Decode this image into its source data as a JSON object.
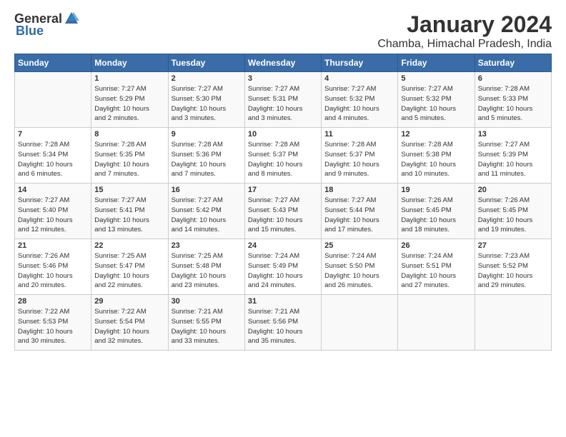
{
  "logo": {
    "general": "General",
    "blue": "Blue"
  },
  "title": {
    "month_year": "January 2024",
    "location": "Chamba, Himachal Pradesh, India"
  },
  "days_of_week": [
    "Sunday",
    "Monday",
    "Tuesday",
    "Wednesday",
    "Thursday",
    "Friday",
    "Saturday"
  ],
  "weeks": [
    [
      {
        "day": "",
        "info": ""
      },
      {
        "day": "1",
        "info": "Sunrise: 7:27 AM\nSunset: 5:29 PM\nDaylight: 10 hours\nand 2 minutes."
      },
      {
        "day": "2",
        "info": "Sunrise: 7:27 AM\nSunset: 5:30 PM\nDaylight: 10 hours\nand 3 minutes."
      },
      {
        "day": "3",
        "info": "Sunrise: 7:27 AM\nSunset: 5:31 PM\nDaylight: 10 hours\nand 3 minutes."
      },
      {
        "day": "4",
        "info": "Sunrise: 7:27 AM\nSunset: 5:32 PM\nDaylight: 10 hours\nand 4 minutes."
      },
      {
        "day": "5",
        "info": "Sunrise: 7:27 AM\nSunset: 5:32 PM\nDaylight: 10 hours\nand 5 minutes."
      },
      {
        "day": "6",
        "info": "Sunrise: 7:28 AM\nSunset: 5:33 PM\nDaylight: 10 hours\nand 5 minutes."
      }
    ],
    [
      {
        "day": "7",
        "info": "Sunrise: 7:28 AM\nSunset: 5:34 PM\nDaylight: 10 hours\nand 6 minutes."
      },
      {
        "day": "8",
        "info": "Sunrise: 7:28 AM\nSunset: 5:35 PM\nDaylight: 10 hours\nand 7 minutes."
      },
      {
        "day": "9",
        "info": "Sunrise: 7:28 AM\nSunset: 5:36 PM\nDaylight: 10 hours\nand 7 minutes."
      },
      {
        "day": "10",
        "info": "Sunrise: 7:28 AM\nSunset: 5:37 PM\nDaylight: 10 hours\nand 8 minutes."
      },
      {
        "day": "11",
        "info": "Sunrise: 7:28 AM\nSunset: 5:37 PM\nDaylight: 10 hours\nand 9 minutes."
      },
      {
        "day": "12",
        "info": "Sunrise: 7:28 AM\nSunset: 5:38 PM\nDaylight: 10 hours\nand 10 minutes."
      },
      {
        "day": "13",
        "info": "Sunrise: 7:27 AM\nSunset: 5:39 PM\nDaylight: 10 hours\nand 11 minutes."
      }
    ],
    [
      {
        "day": "14",
        "info": "Sunrise: 7:27 AM\nSunset: 5:40 PM\nDaylight: 10 hours\nand 12 minutes."
      },
      {
        "day": "15",
        "info": "Sunrise: 7:27 AM\nSunset: 5:41 PM\nDaylight: 10 hours\nand 13 minutes."
      },
      {
        "day": "16",
        "info": "Sunrise: 7:27 AM\nSunset: 5:42 PM\nDaylight: 10 hours\nand 14 minutes."
      },
      {
        "day": "17",
        "info": "Sunrise: 7:27 AM\nSunset: 5:43 PM\nDaylight: 10 hours\nand 15 minutes."
      },
      {
        "day": "18",
        "info": "Sunrise: 7:27 AM\nSunset: 5:44 PM\nDaylight: 10 hours\nand 17 minutes."
      },
      {
        "day": "19",
        "info": "Sunrise: 7:26 AM\nSunset: 5:45 PM\nDaylight: 10 hours\nand 18 minutes."
      },
      {
        "day": "20",
        "info": "Sunrise: 7:26 AM\nSunset: 5:45 PM\nDaylight: 10 hours\nand 19 minutes."
      }
    ],
    [
      {
        "day": "21",
        "info": "Sunrise: 7:26 AM\nSunset: 5:46 PM\nDaylight: 10 hours\nand 20 minutes."
      },
      {
        "day": "22",
        "info": "Sunrise: 7:25 AM\nSunset: 5:47 PM\nDaylight: 10 hours\nand 22 minutes."
      },
      {
        "day": "23",
        "info": "Sunrise: 7:25 AM\nSunset: 5:48 PM\nDaylight: 10 hours\nand 23 minutes."
      },
      {
        "day": "24",
        "info": "Sunrise: 7:24 AM\nSunset: 5:49 PM\nDaylight: 10 hours\nand 24 minutes."
      },
      {
        "day": "25",
        "info": "Sunrise: 7:24 AM\nSunset: 5:50 PM\nDaylight: 10 hours\nand 26 minutes."
      },
      {
        "day": "26",
        "info": "Sunrise: 7:24 AM\nSunset: 5:51 PM\nDaylight: 10 hours\nand 27 minutes."
      },
      {
        "day": "27",
        "info": "Sunrise: 7:23 AM\nSunset: 5:52 PM\nDaylight: 10 hours\nand 29 minutes."
      }
    ],
    [
      {
        "day": "28",
        "info": "Sunrise: 7:22 AM\nSunset: 5:53 PM\nDaylight: 10 hours\nand 30 minutes."
      },
      {
        "day": "29",
        "info": "Sunrise: 7:22 AM\nSunset: 5:54 PM\nDaylight: 10 hours\nand 32 minutes."
      },
      {
        "day": "30",
        "info": "Sunrise: 7:21 AM\nSunset: 5:55 PM\nDaylight: 10 hours\nand 33 minutes."
      },
      {
        "day": "31",
        "info": "Sunrise: 7:21 AM\nSunset: 5:56 PM\nDaylight: 10 hours\nand 35 minutes."
      },
      {
        "day": "",
        "info": ""
      },
      {
        "day": "",
        "info": ""
      },
      {
        "day": "",
        "info": ""
      }
    ]
  ]
}
